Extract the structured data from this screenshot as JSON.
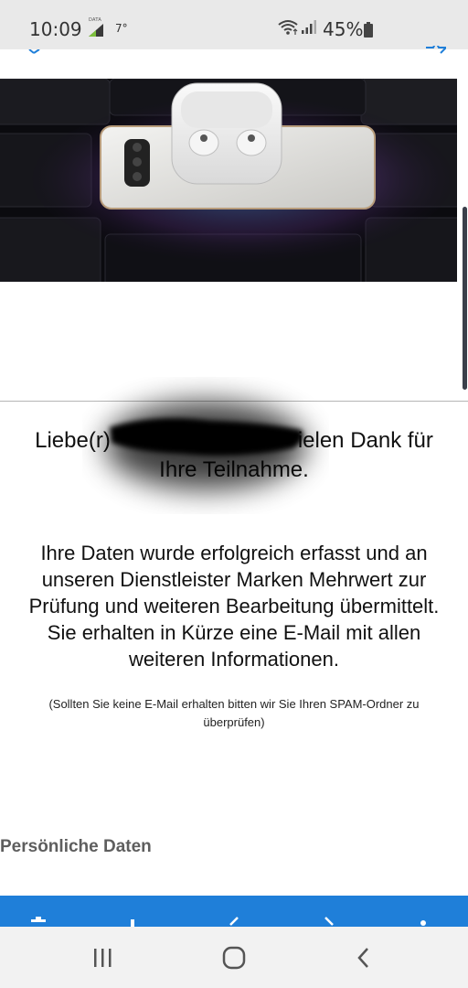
{
  "status_bar": {
    "time": "10:09",
    "data_label": "DATA",
    "temperature": "7°",
    "battery_percent": "45%"
  },
  "hero": {
    "description_icon": "product-image"
  },
  "confirmation": {
    "greeting_prefix": "Liebe(r)",
    "greeting_suffix": "ielen Dank für",
    "greeting_line2": "Ihre Teilnahme.",
    "body_lines": [
      "Ihre Daten wurde erfolgreich erfasst und an",
      "unseren Dienstleister Marken Mehrwert zur",
      "Prüfung und weiteren Bearbeitung übermittelt.",
      "Sie erhalten in Kürze eine E-Mail mit allen",
      "weiteren Informationen."
    ],
    "note_lines": [
      "(Sollten Sie keine E-Mail erhalten bitten wir Sie Ihren SPAM-Ordner zu",
      "überprüfen)"
    ]
  },
  "section": {
    "title": "Persönliche Daten"
  },
  "colors": {
    "accent_blue": "#1f7fd9",
    "status_bg": "#e9e9e9",
    "nav_bg": "#f2f2f2"
  }
}
